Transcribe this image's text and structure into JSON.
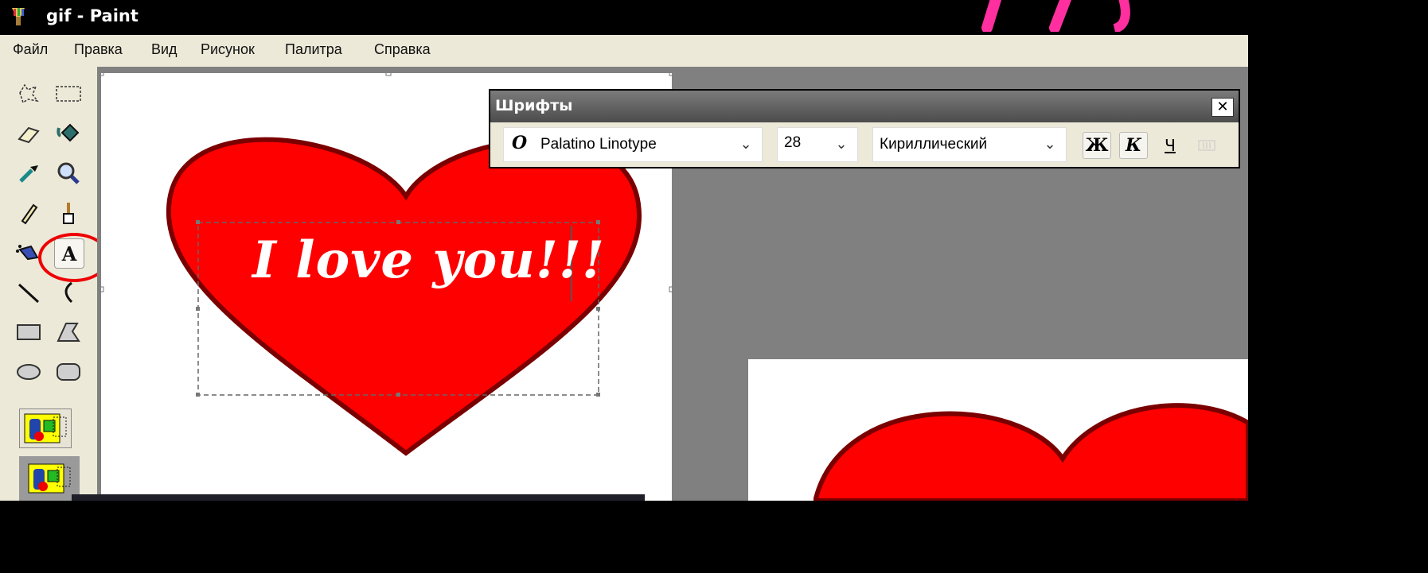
{
  "window": {
    "title": "gif - Paint"
  },
  "menu": [
    "Файл",
    "Правка",
    "Вид",
    "Рисунок",
    "Палитра",
    "Справка"
  ],
  "tools": [
    {
      "left": "free-select-icon",
      "right": "rect-select-icon"
    },
    {
      "left": "eraser-icon",
      "right": "fill-bucket-icon"
    },
    {
      "left": "color-picker-icon",
      "right": "magnifier-icon"
    },
    {
      "left": "pencil-icon",
      "right": "brush-icon"
    },
    {
      "left": "airbrush-icon",
      "right": "text-tool-icon"
    },
    {
      "left": "line-icon",
      "right": "curve-icon"
    },
    {
      "left": "rectangle-icon",
      "right": "polygon-icon"
    },
    {
      "left": "ellipse-icon",
      "right": "rounded-rect-icon"
    }
  ],
  "text_tool_glyph": "A",
  "fonts_toolbar": {
    "title": "Шрифты",
    "close": "✕",
    "font_glyph": "O",
    "font_name": "Palatino Linotype",
    "size": "28",
    "script": "Кириллический",
    "bold": "Ж",
    "italic": "К",
    "underline": "Ч"
  },
  "canvas_text": "I love you!!!",
  "colors": {
    "heart": "#ff0000",
    "heart_outline": "#7a0000",
    "title_accent": "#ff2fa0"
  }
}
